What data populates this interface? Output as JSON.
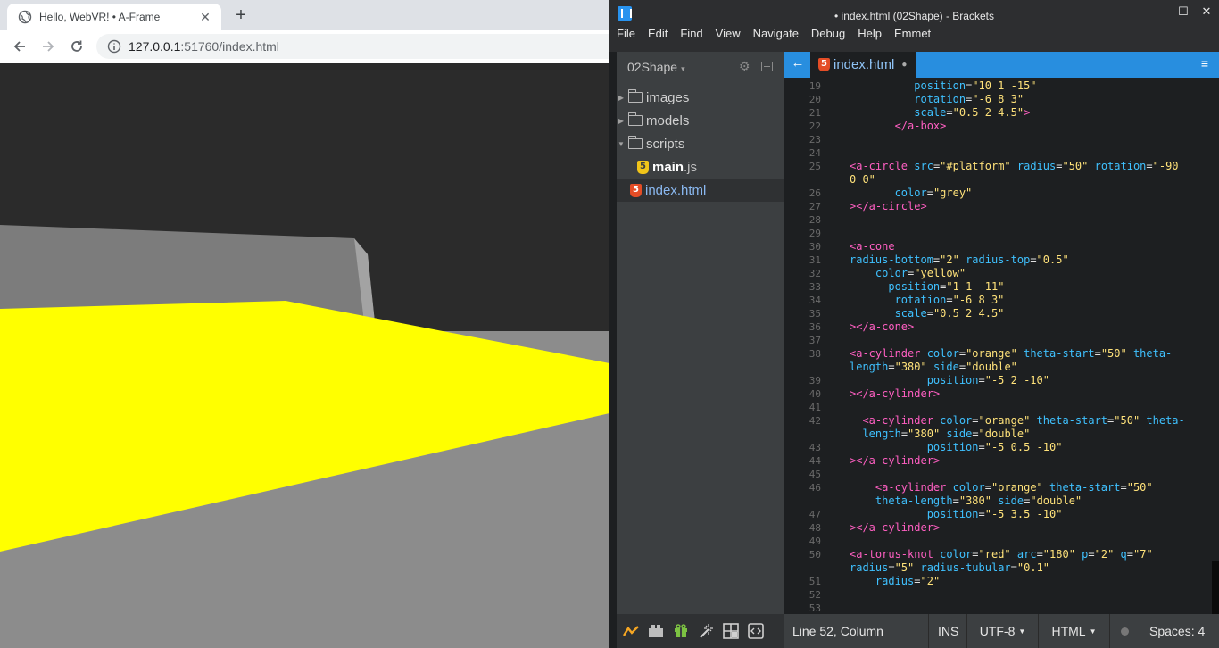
{
  "browser": {
    "tab": {
      "title": "Hello, WebVR! • A-Frame",
      "close": "✕"
    },
    "new_tab": "+",
    "url_host": "127.0.0.1",
    "url_rest": ":51760/index.html",
    "icons": [
      "back-icon",
      "forward-icon",
      "reload-icon",
      "info-icon",
      "globe-icon"
    ],
    "scene_colors": {
      "sky": "#2b2b2b",
      "platform": "#8c8c8c",
      "box": "#ffff00",
      "wall": "#7c7c7c"
    }
  },
  "editor": {
    "window_title": "• index.html (02Shape) - Brackets",
    "window_controls": {
      "minimize": "—",
      "maximize": "☐",
      "close": "✕"
    },
    "menu": [
      "File",
      "Edit",
      "Find",
      "View",
      "Navigate",
      "Debug",
      "Help",
      "Emmet"
    ],
    "project": {
      "name": "02Shape",
      "caret": "▾"
    },
    "tree": [
      {
        "label": "images",
        "type": "folder",
        "expanded": false
      },
      {
        "label": "models",
        "type": "folder",
        "expanded": false
      },
      {
        "label": "scripts",
        "type": "folder",
        "expanded": true
      },
      {
        "label_name": "main",
        "label_ext": ".js",
        "type": "js"
      },
      {
        "label": "index.html",
        "type": "html",
        "selected": true
      }
    ],
    "active_file": "index.html",
    "accent": "#288edf",
    "code_lines": [
      {
        "n": "19",
        "parts": [
          [
            "plain",
            "          "
          ],
          [
            "attr",
            "position"
          ],
          [
            "plain",
            "="
          ],
          [
            "val",
            "\"10 1 -15\""
          ]
        ]
      },
      {
        "n": "20",
        "parts": [
          [
            "plain",
            "          "
          ],
          [
            "attr",
            "rotation"
          ],
          [
            "plain",
            "="
          ],
          [
            "val",
            "\"-6 8 3\""
          ]
        ]
      },
      {
        "n": "21",
        "parts": [
          [
            "plain",
            "          "
          ],
          [
            "attr",
            "scale"
          ],
          [
            "plain",
            "="
          ],
          [
            "val",
            "\"0.5 2 4.5\""
          ],
          [
            "tag",
            ">"
          ]
        ]
      },
      {
        "n": "22",
        "parts": [
          [
            "plain",
            "       "
          ],
          [
            "tag",
            "</a-box>"
          ]
        ]
      },
      {
        "n": "23",
        "parts": []
      },
      {
        "n": "24",
        "parts": []
      },
      {
        "n": "25",
        "parts": [
          [
            "tag",
            "<a-circle "
          ],
          [
            "attr",
            "src"
          ],
          [
            "plain",
            "="
          ],
          [
            "val",
            "\"#platform\" "
          ],
          [
            "attr",
            "radius"
          ],
          [
            "plain",
            "="
          ],
          [
            "val",
            "\"50\" "
          ],
          [
            "attr",
            "rotation"
          ],
          [
            "plain",
            "="
          ],
          [
            "val",
            "\"-90"
          ]
        ]
      },
      {
        "n": "",
        "parts": [
          [
            "val",
            "0 0\""
          ]
        ]
      },
      {
        "n": "26",
        "parts": [
          [
            "plain",
            "       "
          ],
          [
            "attr",
            "color"
          ],
          [
            "plain",
            "="
          ],
          [
            "val",
            "\"grey\""
          ]
        ]
      },
      {
        "n": "27",
        "parts": [
          [
            "tag",
            "></a-circle>"
          ]
        ]
      },
      {
        "n": "28",
        "parts": []
      },
      {
        "n": "29",
        "parts": []
      },
      {
        "n": "30",
        "parts": [
          [
            "tag",
            "<a-cone"
          ]
        ]
      },
      {
        "n": "31",
        "parts": [
          [
            "attr",
            "radius-bottom"
          ],
          [
            "plain",
            "="
          ],
          [
            "val",
            "\"2\" "
          ],
          [
            "attr",
            "radius-top"
          ],
          [
            "plain",
            "="
          ],
          [
            "val",
            "\"0.5\""
          ]
        ]
      },
      {
        "n": "32",
        "parts": [
          [
            "plain",
            "    "
          ],
          [
            "attr",
            "color"
          ],
          [
            "plain",
            "="
          ],
          [
            "val",
            "\"yellow\""
          ]
        ]
      },
      {
        "n": "33",
        "parts": [
          [
            "plain",
            "      "
          ],
          [
            "attr",
            "position"
          ],
          [
            "plain",
            "="
          ],
          [
            "val",
            "\"1 1 -11\""
          ]
        ]
      },
      {
        "n": "34",
        "parts": [
          [
            "plain",
            "       "
          ],
          [
            "attr",
            "rotation"
          ],
          [
            "plain",
            "="
          ],
          [
            "val",
            "\"-6 8 3\""
          ]
        ]
      },
      {
        "n": "35",
        "parts": [
          [
            "plain",
            "       "
          ],
          [
            "attr",
            "scale"
          ],
          [
            "plain",
            "="
          ],
          [
            "val",
            "\"0.5 2 4.5\""
          ]
        ]
      },
      {
        "n": "36",
        "parts": [
          [
            "tag",
            "></a-cone>"
          ]
        ]
      },
      {
        "n": "37",
        "parts": []
      },
      {
        "n": "38",
        "parts": [
          [
            "tag",
            "<a-cylinder "
          ],
          [
            "attr",
            "color"
          ],
          [
            "plain",
            "="
          ],
          [
            "val",
            "\"orange\" "
          ],
          [
            "attr",
            "theta-start"
          ],
          [
            "plain",
            "="
          ],
          [
            "val",
            "\"50\" "
          ],
          [
            "attr",
            "theta-"
          ]
        ]
      },
      {
        "n": "",
        "parts": [
          [
            "attr",
            "length"
          ],
          [
            "plain",
            "="
          ],
          [
            "val",
            "\"380\" "
          ],
          [
            "attr",
            "side"
          ],
          [
            "plain",
            "="
          ],
          [
            "val",
            "\"double\""
          ]
        ]
      },
      {
        "n": "39",
        "parts": [
          [
            "plain",
            "            "
          ],
          [
            "attr",
            "position"
          ],
          [
            "plain",
            "="
          ],
          [
            "val",
            "\"-5 2 -10\""
          ]
        ]
      },
      {
        "n": "40",
        "parts": [
          [
            "tag",
            "></a-cylinder>"
          ]
        ]
      },
      {
        "n": "41",
        "parts": []
      },
      {
        "n": "42",
        "parts": [
          [
            "plain",
            "  "
          ],
          [
            "tag",
            "<a-cylinder "
          ],
          [
            "attr",
            "color"
          ],
          [
            "plain",
            "="
          ],
          [
            "val",
            "\"orange\" "
          ],
          [
            "attr",
            "theta-start"
          ],
          [
            "plain",
            "="
          ],
          [
            "val",
            "\"50\" "
          ],
          [
            "attr",
            "theta-"
          ]
        ]
      },
      {
        "n": "",
        "parts": [
          [
            "plain",
            "  "
          ],
          [
            "attr",
            "length"
          ],
          [
            "plain",
            "="
          ],
          [
            "val",
            "\"380\" "
          ],
          [
            "attr",
            "side"
          ],
          [
            "plain",
            "="
          ],
          [
            "val",
            "\"double\""
          ]
        ]
      },
      {
        "n": "43",
        "parts": [
          [
            "plain",
            "            "
          ],
          [
            "attr",
            "position"
          ],
          [
            "plain",
            "="
          ],
          [
            "val",
            "\"-5 0.5 -10\""
          ]
        ]
      },
      {
        "n": "44",
        "parts": [
          [
            "tag",
            "></a-cylinder>"
          ]
        ]
      },
      {
        "n": "45",
        "parts": []
      },
      {
        "n": "46",
        "parts": [
          [
            "plain",
            "    "
          ],
          [
            "tag",
            "<a-cylinder "
          ],
          [
            "attr",
            "color"
          ],
          [
            "plain",
            "="
          ],
          [
            "val",
            "\"orange\" "
          ],
          [
            "attr",
            "theta-start"
          ],
          [
            "plain",
            "="
          ],
          [
            "val",
            "\"50\""
          ]
        ]
      },
      {
        "n": "",
        "parts": [
          [
            "plain",
            "    "
          ],
          [
            "attr",
            "theta-length"
          ],
          [
            "plain",
            "="
          ],
          [
            "val",
            "\"380\" "
          ],
          [
            "attr",
            "side"
          ],
          [
            "plain",
            "="
          ],
          [
            "val",
            "\"double\""
          ]
        ]
      },
      {
        "n": "47",
        "parts": [
          [
            "plain",
            "            "
          ],
          [
            "attr",
            "position"
          ],
          [
            "plain",
            "="
          ],
          [
            "val",
            "\"-5 3.5 -10\""
          ]
        ]
      },
      {
        "n": "48",
        "parts": [
          [
            "tag",
            "></a-cylinder>"
          ]
        ]
      },
      {
        "n": "49",
        "parts": []
      },
      {
        "n": "50",
        "parts": [
          [
            "tag",
            "<a-torus-knot "
          ],
          [
            "attr",
            "color"
          ],
          [
            "plain",
            "="
          ],
          [
            "val",
            "\"red\" "
          ],
          [
            "attr",
            "arc"
          ],
          [
            "plain",
            "="
          ],
          [
            "val",
            "\"180\" "
          ],
          [
            "attr",
            "p"
          ],
          [
            "plain",
            "="
          ],
          [
            "val",
            "\"2\" "
          ],
          [
            "attr",
            "q"
          ],
          [
            "plain",
            "="
          ],
          [
            "val",
            "\"7\""
          ]
        ]
      },
      {
        "n": "",
        "parts": [
          [
            "attr",
            "radius"
          ],
          [
            "plain",
            "="
          ],
          [
            "val",
            "\"5\" "
          ],
          [
            "attr",
            "radius-tubular"
          ],
          [
            "plain",
            "="
          ],
          [
            "val",
            "\"0.1\""
          ]
        ]
      },
      {
        "n": "51",
        "parts": [
          [
            "plain",
            "    "
          ],
          [
            "attr",
            "radius"
          ],
          [
            "plain",
            "="
          ],
          [
            "val",
            "\"2\""
          ]
        ]
      },
      {
        "n": "52",
        "parts": []
      },
      {
        "n": "53",
        "parts": []
      }
    ],
    "status": {
      "cursor": "Line 52, Column",
      "mode": "INS",
      "encoding": "UTF-8",
      "language": "HTML",
      "spaces": "Spaces: 4"
    },
    "bottom_icons": [
      "live-preview-icon",
      "extension-manager-icon",
      "gift-icon",
      "magic-wand-icon",
      "grid-icon",
      "code-icon"
    ]
  }
}
